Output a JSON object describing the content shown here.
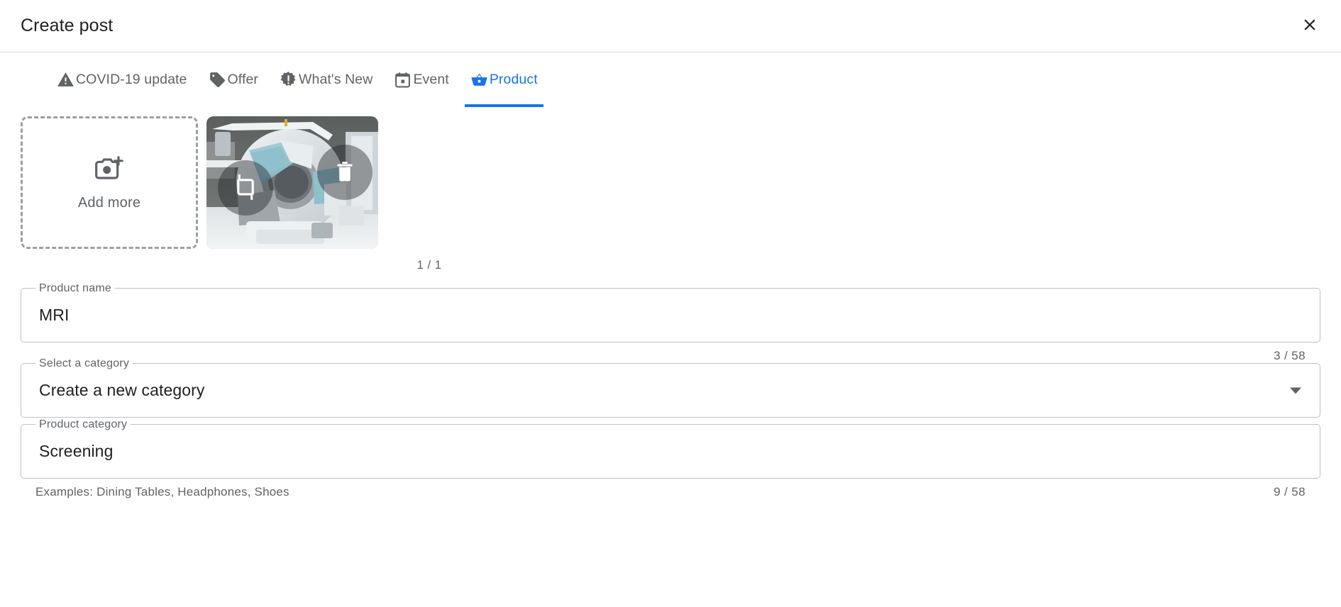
{
  "dialog": {
    "title": "Create post",
    "close_icon": "close-icon"
  },
  "tabs": [
    {
      "id": "covid",
      "label": "COVID-19 update",
      "icon": "warning-triangle-icon",
      "active": false
    },
    {
      "id": "offer",
      "label": "Offer",
      "icon": "price-tag-icon",
      "active": false
    },
    {
      "id": "whats-new",
      "label": "What's New",
      "icon": "starburst-exclamation-icon",
      "active": false
    },
    {
      "id": "event",
      "label": "Event",
      "icon": "calendar-icon",
      "active": false
    },
    {
      "id": "product",
      "label": "Product",
      "icon": "shopping-basket-icon",
      "active": true
    }
  ],
  "media": {
    "add_more_label": "Add more",
    "add_more_icon": "add-photo-icon",
    "crop_icon": "crop-icon",
    "delete_icon": "trash-icon",
    "counter": "1 / 1",
    "thumbnail_alt": "MRI scanner machine in a clinical room"
  },
  "fields": {
    "product_name": {
      "label": "Product name",
      "value": "MRI",
      "placeholder": "Product name",
      "counter": "3 / 58"
    },
    "category_select": {
      "label": "Select a category",
      "value": "Create a new category",
      "arrow_icon": "chevron-down-icon",
      "options": [
        "Create a new category"
      ]
    },
    "product_category": {
      "label": "Product category",
      "value": "Screening",
      "placeholder": "Product category",
      "helper": "Examples: Dining Tables, Headphones, Shoes",
      "counter": "9 / 58"
    }
  },
  "colors": {
    "accent": "#1a73e8",
    "text_primary": "#202124",
    "text_secondary": "#5f6368",
    "border": "#bdc1c6",
    "divider": "#dadce0"
  }
}
